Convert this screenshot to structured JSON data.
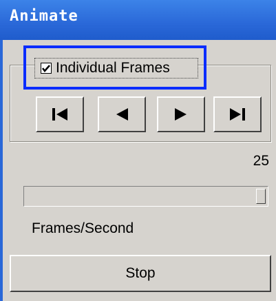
{
  "window": {
    "title": "Animate"
  },
  "options": {
    "individual_frames_label": "Individual Frames",
    "individual_frames_checked": true
  },
  "playback": {
    "buttons": [
      {
        "name": "first-frame",
        "icon": "skip-to-start-icon"
      },
      {
        "name": "previous-frame",
        "icon": "step-back-icon"
      },
      {
        "name": "next-frame",
        "icon": "step-forward-icon"
      },
      {
        "name": "last-frame",
        "icon": "skip-to-end-icon"
      }
    ]
  },
  "speed": {
    "value": "25",
    "label": "Frames/Second",
    "slider_fraction": 1.0
  },
  "actions": {
    "stop_label": "Stop"
  },
  "colors": {
    "titlebar": "#2a68d8",
    "highlight_border": "#0a2cff",
    "panel": "#d6d3ce"
  }
}
